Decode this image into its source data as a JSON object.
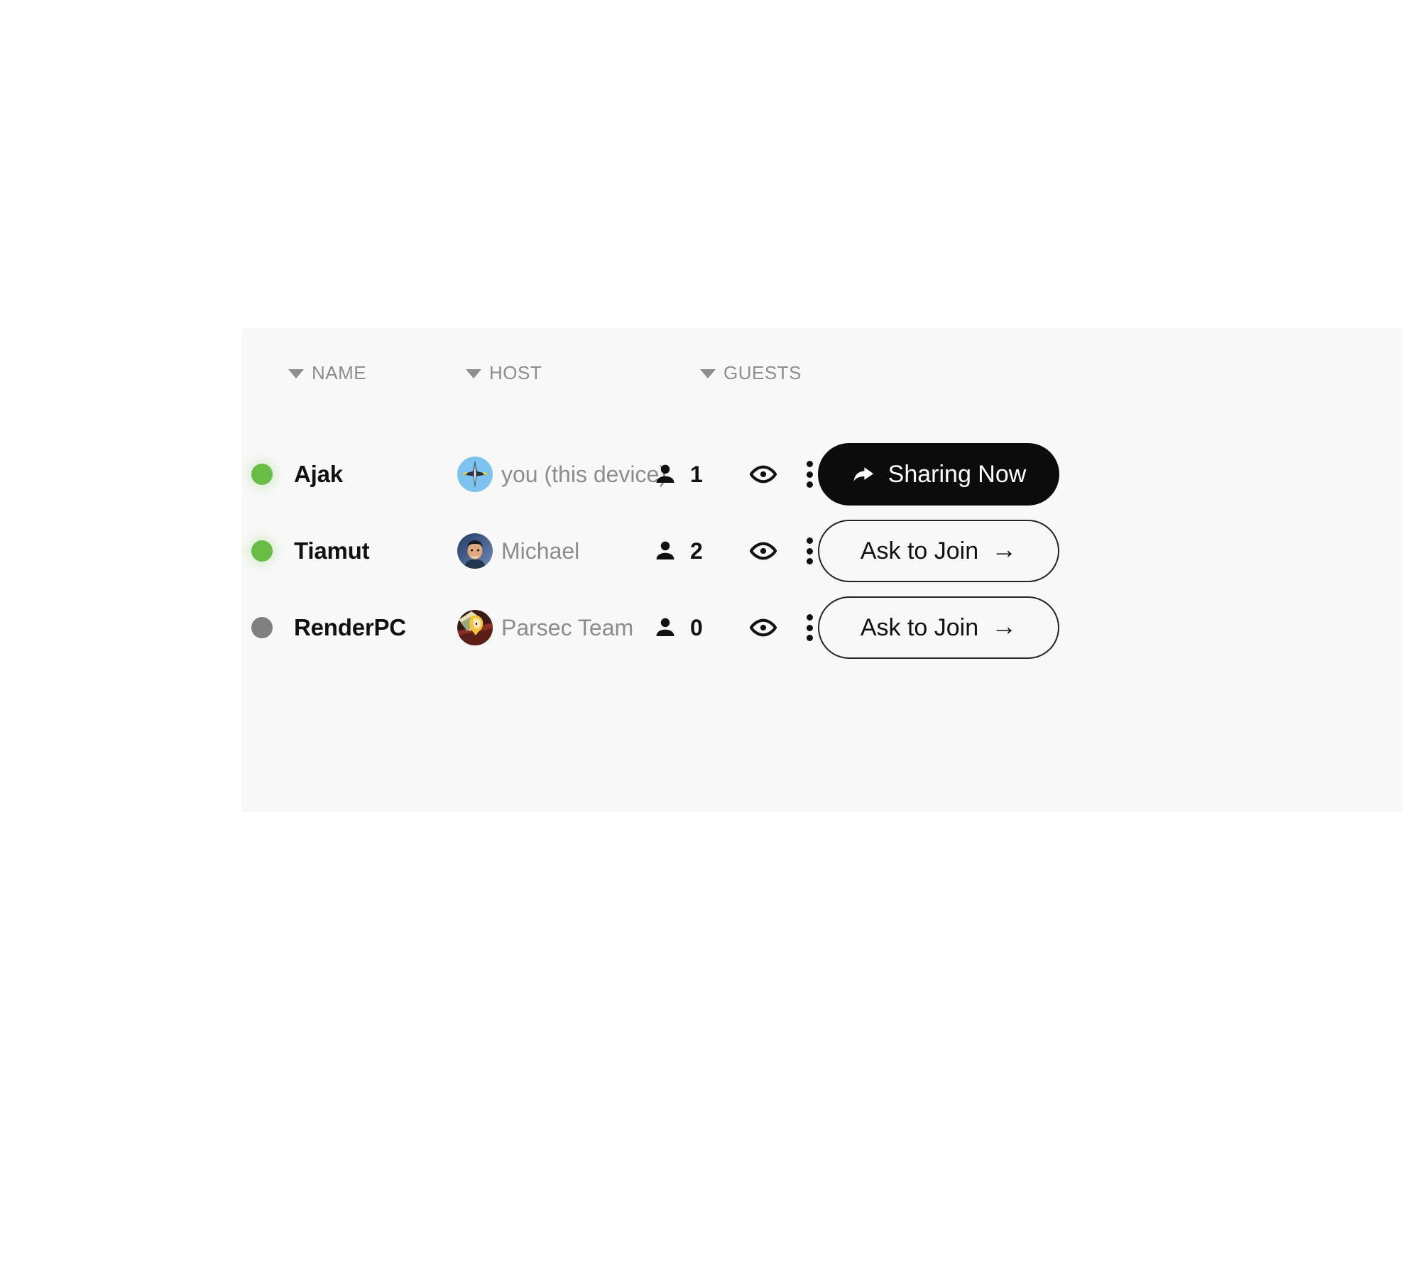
{
  "panel": {
    "background_color": "#f8f8f8"
  },
  "table": {
    "columns": [
      {
        "key": "name",
        "label": "NAME",
        "sort_icon": "caret-down-icon"
      },
      {
        "key": "host",
        "label": "HOST",
        "sort_icon": "caret-down-icon"
      },
      {
        "key": "guests",
        "label": "GUESTS",
        "sort_icon": "caret-down-icon"
      }
    ],
    "rows": [
      {
        "name": "Ajak",
        "status": "online",
        "status_color": "#67bd45",
        "host": "you (this device)",
        "avatar": "jet-avatar",
        "guests": "1",
        "guests_icon": "person-icon",
        "eye_icon": "eye-icon",
        "menu_icon": "kebab-menu-icon",
        "action_label": "Sharing Now",
        "action_icon": "share-arrow-icon",
        "action_style": "primary"
      },
      {
        "name": "Tiamut",
        "status": "online",
        "status_color": "#67bd45",
        "host": "Michael",
        "avatar": "person-photo-avatar",
        "guests": "2",
        "guests_icon": "person-icon",
        "eye_icon": "eye-icon",
        "menu_icon": "kebab-menu-icon",
        "action_label": "Ask to Join",
        "action_icon": "arrow-right-icon",
        "action_style": "secondary"
      },
      {
        "name": "RenderPC",
        "status": "offline",
        "status_color": "#808080",
        "host": "Parsec Team",
        "avatar": "parsec-mascot-avatar",
        "guests": "0",
        "guests_icon": "person-icon",
        "eye_icon": "eye-icon",
        "menu_icon": "kebab-menu-icon",
        "action_label": "Ask to Join",
        "action_icon": "arrow-right-icon",
        "action_style": "secondary"
      }
    ]
  }
}
